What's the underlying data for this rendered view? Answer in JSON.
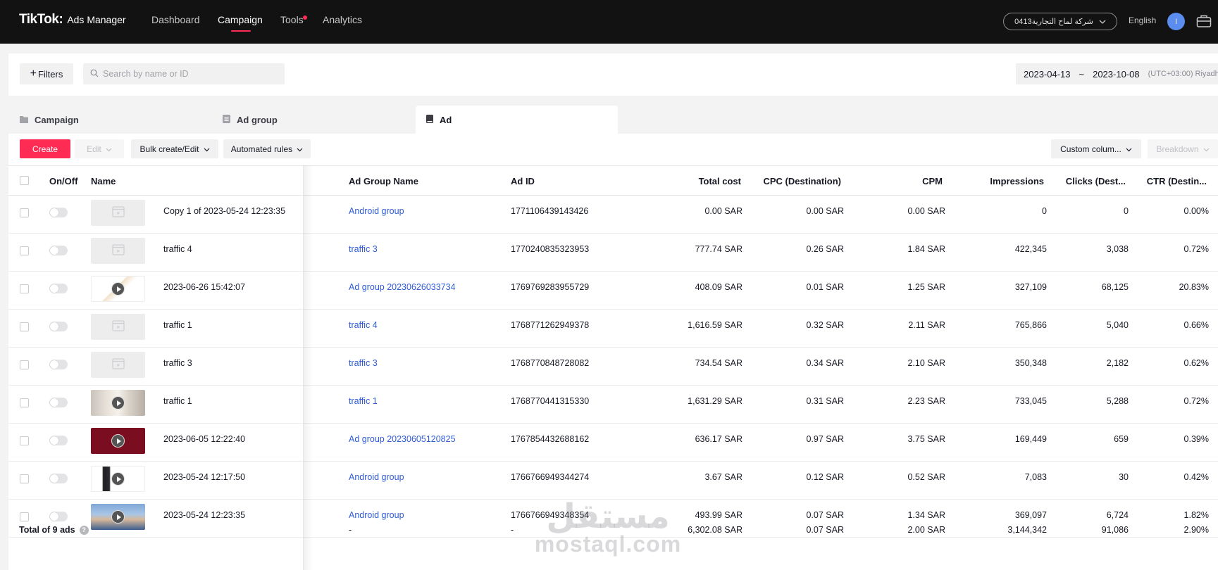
{
  "header": {
    "brand": "TikTok",
    "brand_separator": ":",
    "product": "Ads Manager",
    "nav": [
      {
        "label": "Dashboard",
        "active": false
      },
      {
        "label": "Campaign",
        "active": true
      },
      {
        "label": "Tools",
        "active": false,
        "has_dot": true
      },
      {
        "label": "Analytics",
        "active": false
      }
    ],
    "account": "0413شركة لماح التجارية",
    "language": "English",
    "avatar_initial": "I"
  },
  "filterbar": {
    "filters_label": "Filters",
    "search_placeholder": "Search by name or ID",
    "date_start": "2023-04-13",
    "date_sep": "~",
    "date_end": "2023-10-08",
    "timezone": "(UTC+03:00) Riyadh"
  },
  "tabs": [
    {
      "label": "Campaign",
      "active": false
    },
    {
      "label": "Ad group",
      "active": false
    },
    {
      "label": "Ad",
      "active": true
    }
  ],
  "toolbar": {
    "create": "Create",
    "edit": "Edit",
    "bulk": "Bulk create/Edit",
    "rules": "Automated rules",
    "custom_columns": "Custom colum...",
    "breakdown": "Breakdown"
  },
  "table": {
    "columns": [
      "On/Off",
      "Name",
      "Ad Group Name",
      "Ad ID",
      "Total cost",
      "CPC (Destination)",
      "CPM",
      "Impressions",
      "Clicks (Dest...",
      "CTR (Destin..."
    ],
    "rows": [
      {
        "name": "Copy 1 of 2023-05-24 12:23:35",
        "thumb": "empty",
        "group": "Android group",
        "id": "1771106439143426",
        "cost": "0.00 SAR",
        "cpc": "0.00 SAR",
        "cpm": "0.00 SAR",
        "impr": "0",
        "clicks": "0",
        "ctr": "0.00%"
      },
      {
        "name": "traffic 4",
        "thumb": "empty",
        "group": "traffic 3",
        "id": "1770240835323953",
        "cost": "777.74 SAR",
        "cpc": "0.26 SAR",
        "cpm": "1.84 SAR",
        "impr": "422,345",
        "clicks": "3,038",
        "ctr": "0.72%"
      },
      {
        "name": "2023-06-26 15:42:07",
        "thumb": "promo",
        "group": "Ad group 20230626033734",
        "id": "1769769283955729",
        "cost": "408.09 SAR",
        "cpc": "0.01 SAR",
        "cpm": "1.25 SAR",
        "impr": "327,109",
        "clicks": "68,125",
        "ctr": "20.83%"
      },
      {
        "name": "traffic 1",
        "thumb": "empty",
        "group": "traffic 4",
        "id": "1768771262949378",
        "cost": "1,616.59 SAR",
        "cpc": "0.32 SAR",
        "cpm": "2.11 SAR",
        "impr": "765,866",
        "clicks": "5,040",
        "ctr": "0.66%"
      },
      {
        "name": "traffic 3",
        "thumb": "empty",
        "group": "traffic 3",
        "id": "1768770848728082",
        "cost": "734.54 SAR",
        "cpc": "0.34 SAR",
        "cpm": "2.10 SAR",
        "impr": "350,348",
        "clicks": "2,182",
        "ctr": "0.62%"
      },
      {
        "name": "traffic 1",
        "thumb": "person",
        "group": "traffic 1",
        "id": "1768770441315330",
        "cost": "1,631.29 SAR",
        "cpc": "0.31 SAR",
        "cpm": "2.23 SAR",
        "impr": "733,045",
        "clicks": "5,288",
        "ctr": "0.72%"
      },
      {
        "name": "2023-06-05 12:22:40",
        "thumb": "maroon",
        "group": "Ad group 20230605120825",
        "id": "1767854432688162",
        "cost": "636.17 SAR",
        "cpc": "0.97 SAR",
        "cpm": "3.75 SAR",
        "impr": "169,449",
        "clicks": "659",
        "ctr": "0.39%"
      },
      {
        "name": "2023-05-24 12:17:50",
        "thumb": "suit",
        "group": "Android group",
        "id": "1766766949344274",
        "cost": "3.67 SAR",
        "cpc": "0.12 SAR",
        "cpm": "0.52 SAR",
        "impr": "7,083",
        "clicks": "30",
        "ctr": "0.42%"
      },
      {
        "name": "2023-05-24 12:23:35",
        "thumb": "cartoon",
        "group": "Android group",
        "id": "1766766949348354",
        "cost": "493.99 SAR",
        "cpc": "0.07 SAR",
        "cpm": "1.34 SAR",
        "impr": "369,097",
        "clicks": "6,724",
        "ctr": "1.82%"
      }
    ],
    "total": {
      "label": "Total of 9 ads",
      "group": "-",
      "id": "-",
      "cost": "6,302.08 SAR",
      "cpc": "0.07 SAR",
      "cpm": "2.00 SAR",
      "impr": "3,144,342",
      "clicks": "91,086",
      "ctr": "2.90%"
    }
  },
  "watermark": {
    "arabic": "مستقل",
    "latin": "mostaql.com"
  },
  "colors": {
    "accent": "#fe2c55",
    "link": "#2e5bd6",
    "topbar": "#121212"
  }
}
